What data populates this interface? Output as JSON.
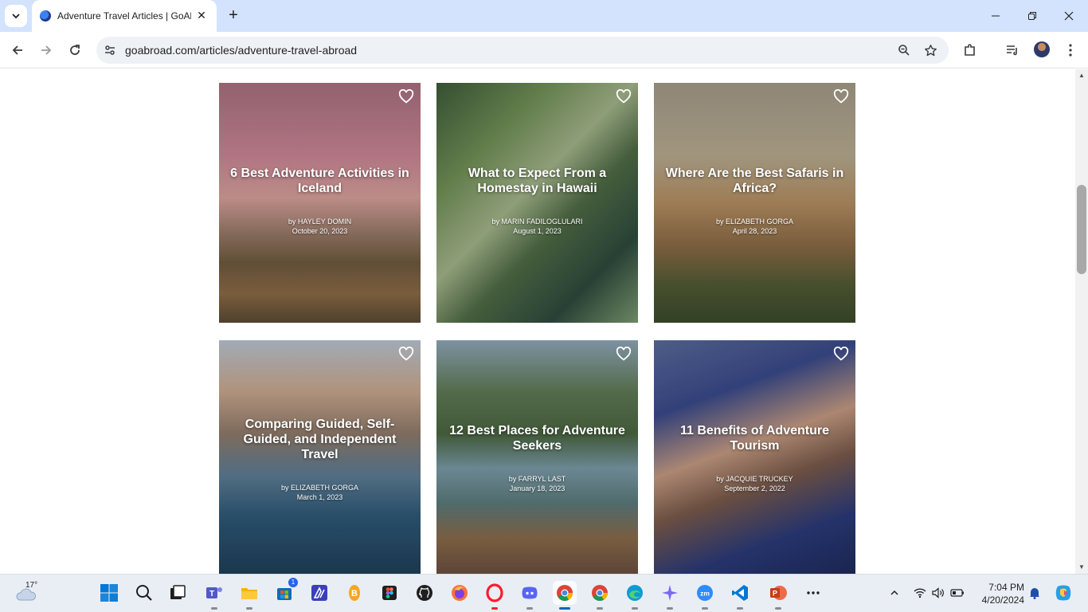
{
  "browser": {
    "tab": {
      "title": "Adventure Travel Articles | GoAbroad.com"
    },
    "url": "goabroad.com/articles/adventure-travel-abroad"
  },
  "articles": [
    {
      "title": "6 Best Adventure Activities in Iceland",
      "by": "by",
      "author": "HAYLEY DOMIN",
      "date": "October 20, 2023"
    },
    {
      "title": "What to Expect From a Homestay in Hawaii",
      "by": "by",
      "author": "MARIN FADILOGLULARI",
      "date": "August 1, 2023"
    },
    {
      "title": "Where Are the Best Safaris in Africa?",
      "by": "by",
      "author": "ELIZABETH GORGA",
      "date": "April 28, 2023"
    },
    {
      "title": "Comparing Guided, Self-Guided, and Independent Travel",
      "by": "by",
      "author": "ELIZABETH GORGA",
      "date": "March 1, 2023"
    },
    {
      "title": "12 Best Places for Adventure Seekers",
      "by": "by",
      "author": "FARRYL LAST",
      "date": "January 18, 2023"
    },
    {
      "title": "11 Benefits of Adventure Tourism",
      "by": "by",
      "author": "JACQUIE TRUCKEY",
      "date": "September 2, 2022"
    }
  ],
  "taskbar": {
    "weather_temp": "17°",
    "teams_badge": "1",
    "time": "7:04 PM",
    "date": "4/20/2024"
  },
  "colors": {
    "tabbar": "#d3e3fd",
    "accent": "#0067c0"
  }
}
